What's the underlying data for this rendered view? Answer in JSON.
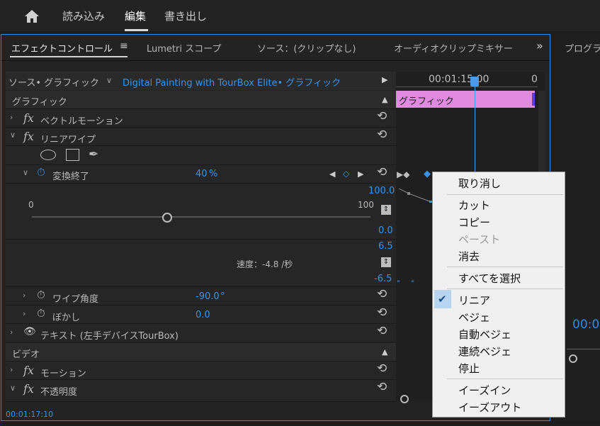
{
  "topnav": {
    "home_icon": "home-icon",
    "items": [
      "読み込み",
      "編集",
      "書き出し"
    ],
    "active": "編集"
  },
  "tabs": {
    "effect_controls": "エフェクトコントロール",
    "lumetri": "Lumetri スコープ",
    "source": "ソース：(クリップなし)",
    "audio_mixer": "オーディオクリップミキサー",
    "overflow": "»",
    "program": "プログラ"
  },
  "source_bar": {
    "source": "ソース• グラフィック",
    "clip": "Digital Painting with TourBox Elite• グラフィック"
  },
  "timeline": {
    "timecode": "00:01:15:00",
    "end_tick": "0",
    "clip_label": "グラフィック"
  },
  "sections": {
    "graphic": "グラフィック",
    "video": "ビデオ"
  },
  "rows": {
    "vector_motion": "ベクトルモーション",
    "linear_wipe": "リニアワイプ",
    "transition_end": {
      "label": "変換終了",
      "value": "40",
      "unit": "%"
    },
    "scale": {
      "min": "0",
      "max": "100",
      "value_max": "100.0",
      "value_min": "0.0",
      "progress": 0.4
    },
    "velocity": {
      "top": "6.5",
      "bottom": "-6.5",
      "label": "速度：-4.8 /秒"
    },
    "wipe_angle": {
      "label": "ワイプ角度",
      "value": "-90.0",
      "unit": "°"
    },
    "feather": {
      "label": "ぼかし",
      "value": "0.0"
    },
    "text": "テキスト (左手デバイスTourBox)",
    "motion": "モーション",
    "opacity": "不透明度"
  },
  "footer": {
    "timecode": "00:01:17:10"
  },
  "right_timecode": "00:0",
  "context_menu": {
    "undo": "取り消し",
    "cut": "カット",
    "copy": "コピー",
    "paste": "ペースト",
    "clear": "消去",
    "select_all": "すべてを選択",
    "linear": "リニア",
    "bezier": "ベジェ",
    "auto_bezier": "自動ベジェ",
    "continuous_bezier": "連続ベジェ",
    "hold": "停止",
    "ease_in": "イーズイン",
    "ease_out": "イーズアウト",
    "checked": "リニア"
  },
  "colors": {
    "accent": "#2d8ceb",
    "clip": "#e08ae0"
  }
}
